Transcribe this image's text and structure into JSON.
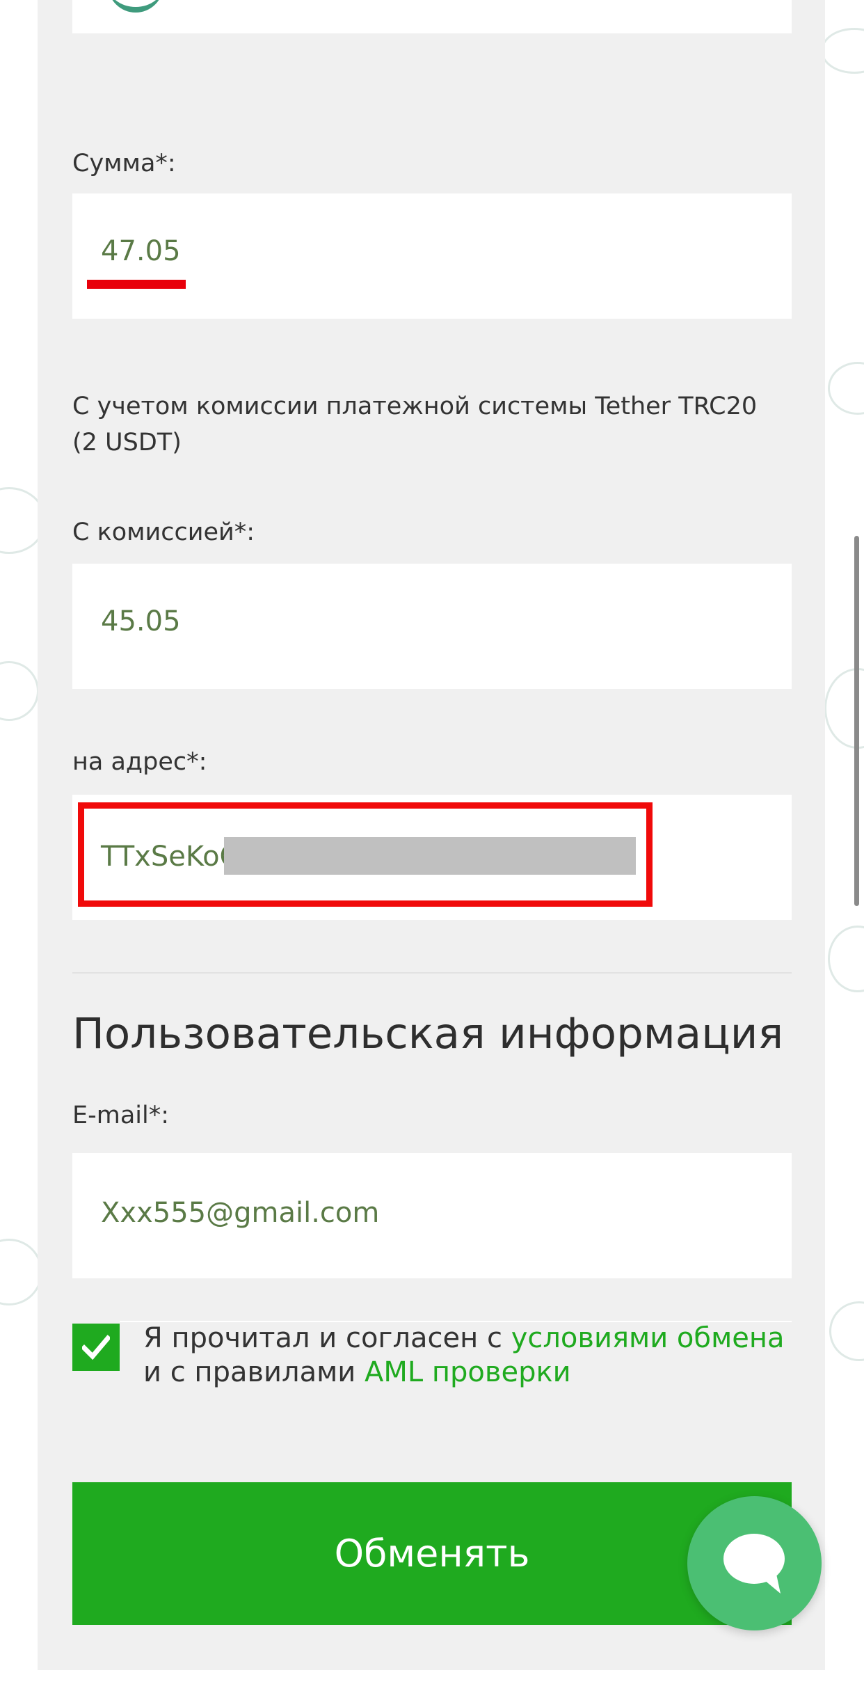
{
  "form": {
    "amount": {
      "label": "Сумма*:",
      "value": "47.05"
    },
    "commission_note": "С учетом комиссии платежной системы Tether TRC20 (2 USDT)",
    "with_commission": {
      "label": "С комиссией*:",
      "value": "45.05"
    },
    "address": {
      "label": "на адрес*:",
      "value": "TTxSeKoC"
    }
  },
  "user_info": {
    "title": "Пользовательская информация",
    "email": {
      "label": "E-mail*:",
      "value": "Xxx555@gmail.com"
    }
  },
  "agreement": {
    "checked": true,
    "text_1": "Я прочитал и согласен с ",
    "link_terms": "условиями обмена",
    "text_2": " и с правилами ",
    "link_aml": "AML проверки"
  },
  "submit_label": "Обменять",
  "colors": {
    "accent_green": "#1faa1f",
    "value_text": "#5a7a46",
    "highlight_red": "#f00a0a",
    "chat_green": "#4bbf73"
  },
  "icons": {
    "checkbox": "check-icon",
    "chat": "chat-bubble-icon"
  }
}
